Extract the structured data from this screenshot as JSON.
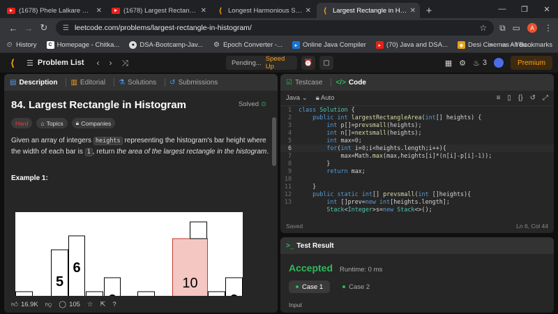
{
  "browser": {
    "tabs": [
      {
        "title": "(1678) Phele Lalkare Naal Main",
        "favicon": "youtube-icon",
        "active": false
      },
      {
        "title": "(1678) Largest Rectangular in H",
        "favicon": "youtube-icon",
        "active": false
      },
      {
        "title": "Longest Harmonious Subseque",
        "favicon": "leetcode-icon",
        "active": false
      },
      {
        "title": "Largest Rectangle in Histogram",
        "favicon": "leetcode-icon",
        "active": true
      }
    ],
    "url": "leetcode.com/problems/largest-rectangle-in-histogram/",
    "profile_initial": "A",
    "bookmarks": [
      {
        "label": "History",
        "icon": "clock-icon"
      },
      {
        "label": "Homepage - Chitka...",
        "icon": "chitkara-icon"
      },
      {
        "label": "DSA-Bootcamp-Jav...",
        "icon": "github-icon"
      },
      {
        "label": "Epoch Converter -...",
        "icon": "gear-icon"
      },
      {
        "label": "Online Java Compiler",
        "icon": "compiler-icon"
      },
      {
        "label": "(70) Java and DSA...",
        "icon": "youtube-icon"
      },
      {
        "label": "Desi Cinemas - You...",
        "icon": "desi-icon"
      }
    ],
    "bookmarks_overflow": "»",
    "all_bookmarks": "All Bookmarks"
  },
  "lc_nav": {
    "problem_list": "Problem List",
    "pending": "Pending...",
    "speed_up": "Speed Up",
    "streak": "3",
    "premium": "Premium"
  },
  "description": {
    "tabs": [
      {
        "label": "Description",
        "icon": "document-icon",
        "active": true
      },
      {
        "label": "Editorial",
        "icon": "book-icon",
        "active": false
      },
      {
        "label": "Solutions",
        "icon": "flask-icon",
        "active": false
      },
      {
        "label": "Submissions",
        "icon": "history-icon",
        "active": false
      }
    ],
    "title": "84. Largest Rectangle in Histogram",
    "solved": "Solved",
    "difficulty": "Hard",
    "topics": "Topics",
    "companies": "Companies",
    "text_1": "Given an array of integers ",
    "code_heights": "heights",
    "text_2": " representing the histogram's bar height where the width of each bar is ",
    "code_one": "1",
    "text_3": ", return ",
    "text_em": "the area of the largest rectangle in the histogram",
    "text_4": ".",
    "example_title": "Example 1:",
    "likes": "16.9K",
    "comments": "105"
  },
  "chart_data": {
    "type": "bar",
    "bars": [
      {
        "label": "2",
        "value": 2
      },
      {
        "label": "1",
        "value": 1
      },
      {
        "label": "5",
        "value": 5
      },
      {
        "label": "6",
        "value": 6
      },
      {
        "label": "2",
        "value": 2
      },
      {
        "label": "3",
        "value": 3
      },
      {
        "label": "2",
        "value": 2
      },
      {
        "label": "1",
        "value": 1
      },
      {
        "label": "10",
        "value": 10
      },
      {
        "label": "2",
        "value": 2
      },
      {
        "label": "3",
        "value": 3
      }
    ],
    "ylim": [
      0,
      7
    ],
    "highlight_color": "#f4c7c3"
  },
  "code_panel": {
    "testcase_tab": "Testcase",
    "code_tab": "Code",
    "language": "Java",
    "auto": "Auto",
    "saved": "Saved",
    "cursor": "Ln 6, Col 44",
    "line_numbers": [
      "1",
      "2",
      "3",
      "4",
      "5",
      "6",
      "7",
      "8",
      "9",
      "10",
      "11",
      "12",
      "13"
    ]
  },
  "result": {
    "title": "Test Result",
    "status": "Accepted",
    "runtime": "Runtime: 0 ms",
    "cases": [
      "Case 1",
      "Case 2"
    ],
    "input_label": "Input"
  },
  "colors": {
    "accent": "#ffa116",
    "accepted": "#2cbb5d",
    "hard": "#f63737"
  }
}
